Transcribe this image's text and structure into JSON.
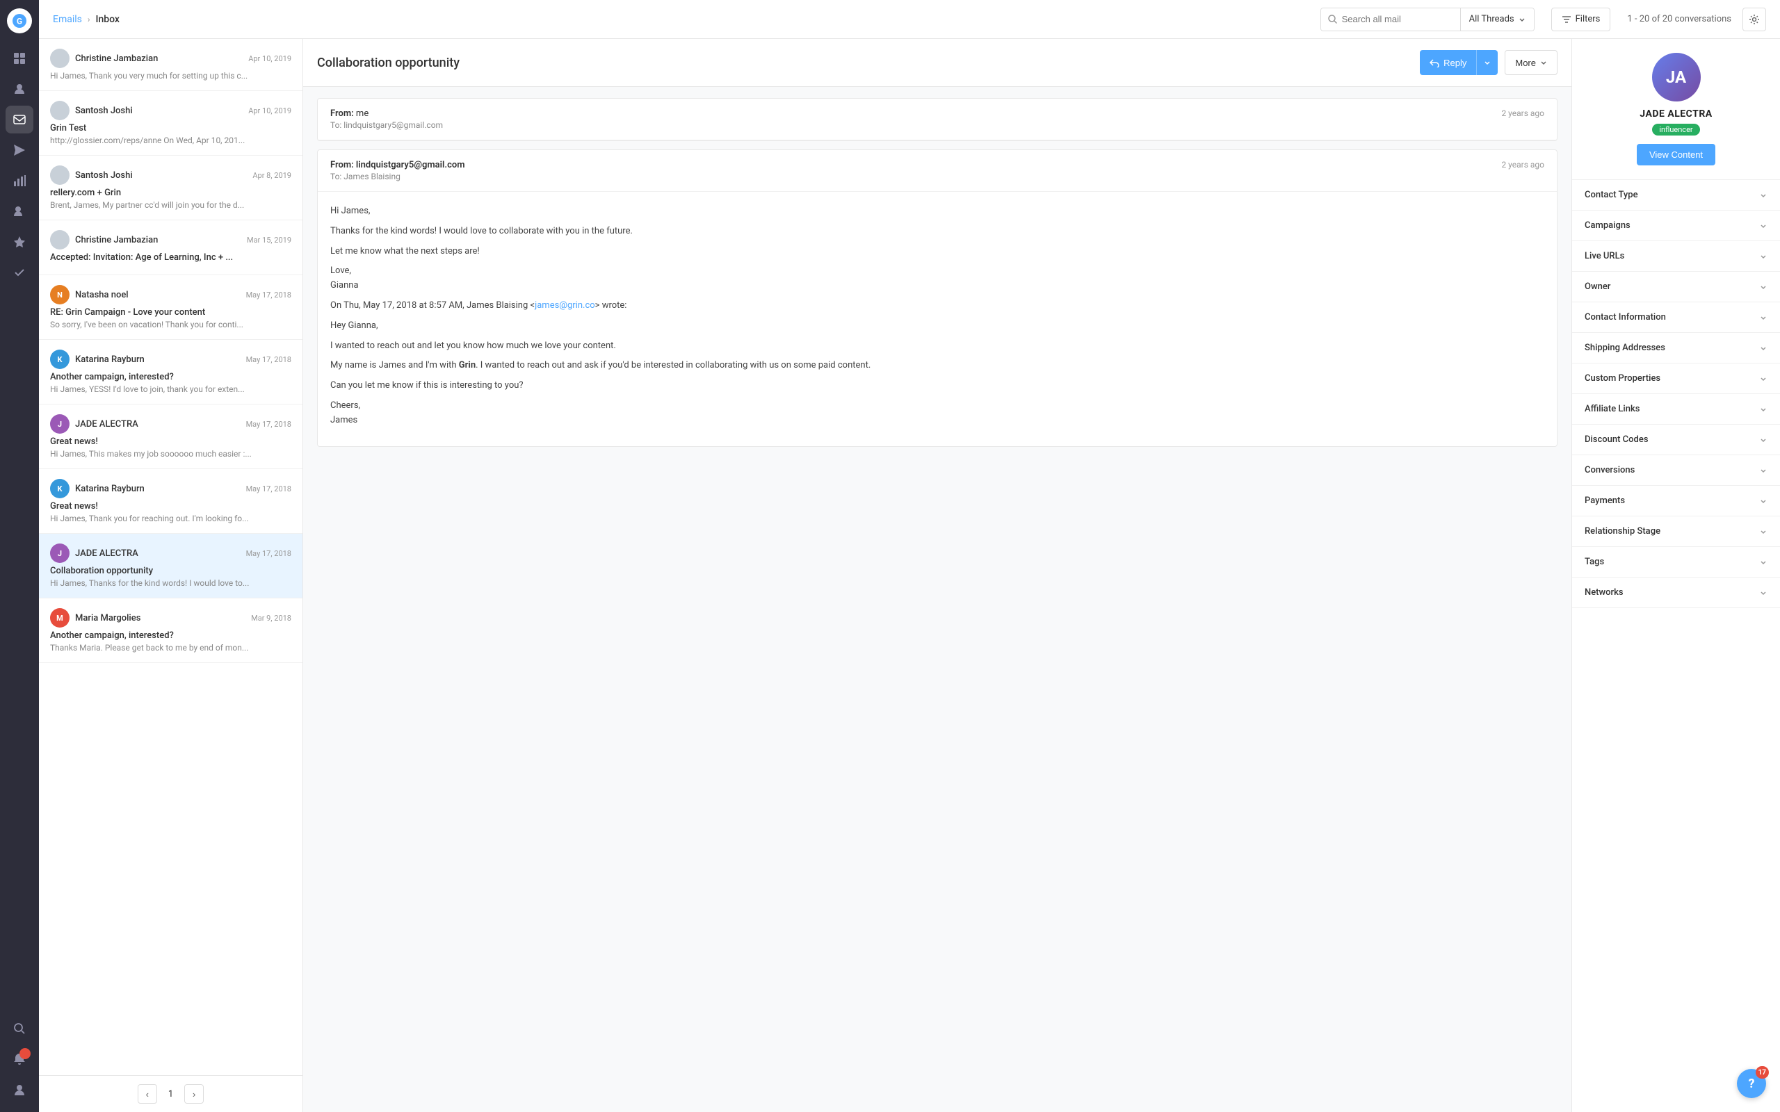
{
  "app": {
    "logo_text": "G"
  },
  "nav": {
    "items": [
      {
        "id": "dashboard",
        "icon": "⊞",
        "active": false
      },
      {
        "id": "contacts",
        "icon": "👤",
        "active": false
      },
      {
        "id": "emails",
        "icon": "✉",
        "active": true
      },
      {
        "id": "send",
        "icon": "➤",
        "active": false
      },
      {
        "id": "reports",
        "icon": "📊",
        "active": false
      },
      {
        "id": "add-user",
        "icon": "➕",
        "active": false
      },
      {
        "id": "starred",
        "icon": "★",
        "active": false
      },
      {
        "id": "checkmark",
        "icon": "✓",
        "active": false
      }
    ],
    "bottom_items": [
      {
        "id": "search",
        "icon": "🔍"
      },
      {
        "id": "alert",
        "icon": "🔔",
        "badge": ""
      },
      {
        "id": "profile",
        "icon": "👤"
      }
    ]
  },
  "header": {
    "breadcrumb_link": "Emails",
    "breadcrumb_sep": "›",
    "breadcrumb_current": "Inbox",
    "search_placeholder": "Search all mail",
    "thread_filter": "All Threads",
    "filter_label": "Filters",
    "conversation_count": "1 - 20 of 20 conversations"
  },
  "email_list": {
    "items": [
      {
        "id": 1,
        "sender": "Christine Jambazian",
        "date": "Apr 10, 2019",
        "subject": "",
        "preview": "Hi James, Thank you very much for setting up this c...",
        "has_avatar": false
      },
      {
        "id": 2,
        "sender": "Santosh Joshi",
        "date": "Apr 10, 2019",
        "subject": "Grin Test",
        "preview": "http://glossier.com/reps/anne On Wed, Apr 10, 201...",
        "has_avatar": false
      },
      {
        "id": 3,
        "sender": "Santosh Joshi",
        "date": "Apr 8, 2019",
        "subject": "rellery.com + Grin",
        "preview": "Brent, James, My partner cc'd will join you for the d...",
        "has_avatar": false
      },
      {
        "id": 4,
        "sender": "Christine Jambazian",
        "date": "Mar 15, 2019",
        "subject": "Accepted: Invitation: Age of Learning, Inc + ...",
        "preview": "",
        "has_avatar": false
      },
      {
        "id": 5,
        "sender": "Natasha noel",
        "date": "May 17, 2018",
        "subject": "RE: Grin Campaign - Love your content",
        "preview": "So sorry, I've been on vacation! Thank you for conti...",
        "has_avatar": true,
        "avatar_color": "#e67e22"
      },
      {
        "id": 6,
        "sender": "Katarina Rayburn",
        "date": "May 17, 2018",
        "subject": "Another campaign, interested?",
        "preview": "Hi James, YESS! I'd love to join, thank you for exten...",
        "has_avatar": true,
        "avatar_color": "#3498db"
      },
      {
        "id": 7,
        "sender": "JADE ALECTRA",
        "date": "May 17, 2018",
        "subject": "Great news!",
        "preview": "Hi James, This makes my job soooooo much easier :...",
        "has_avatar": true,
        "avatar_color": "#9b59b6"
      },
      {
        "id": 8,
        "sender": "Katarina Rayburn",
        "date": "May 17, 2018",
        "subject": "Great news!",
        "preview": "Hi James, Thank you for reaching out. I'm looking fo...",
        "has_avatar": true,
        "avatar_color": "#3498db"
      },
      {
        "id": 9,
        "sender": "JADE ALECTRA",
        "date": "May 17, 2018",
        "subject": "Collaboration opportunity",
        "preview": "Hi James, Thanks for the kind words! I would love to...",
        "has_avatar": true,
        "avatar_color": "#9b59b6",
        "active": true
      },
      {
        "id": 10,
        "sender": "Maria Margolies",
        "date": "Mar 9, 2018",
        "subject": "Another campaign, interested?",
        "preview": "Thanks Maria. Please get back to me by end of mon...",
        "has_avatar": true,
        "avatar_color": "#e74c3c"
      }
    ],
    "pagination": {
      "prev_label": "‹",
      "page": "1",
      "next_label": "›"
    }
  },
  "email_view": {
    "title": "Collaboration opportunity",
    "reply_label": "Reply",
    "more_label": "More",
    "thread": [
      {
        "id": "thread-1",
        "from_label": "From:",
        "from": "me",
        "to_label": "To:",
        "to": "lindquistgary5@gmail.com",
        "time": "2 years ago",
        "body": ""
      },
      {
        "id": "thread-2",
        "from_label": "From:",
        "from": "lindquistgary5@gmail.com",
        "to_label": "To:",
        "to": "James Blaising",
        "time": "2 years ago",
        "greeting": "Hi James,",
        "lines": [
          "Thanks for the kind words! I would love to collaborate with you in the future.",
          "",
          "Let me know what the next steps are!",
          "",
          "Love,",
          "Gianna",
          "",
          "On Thu, May 17, 2018 at 8:57 AM, James Blaising <james@grin.co> wrote:",
          "",
          "Hey Gianna,",
          "",
          "I wanted to reach out and let you know how much we love your content.",
          "",
          "My name is James and I'm with Grin. I wanted to reach out and ask if you'd be interested in collaborating with us on some paid content.",
          "",
          "Can you let me know if this is interesting to you?",
          "",
          "Cheers,",
          "James"
        ]
      }
    ]
  },
  "right_panel": {
    "contact": {
      "name": "JADE ALECTRA",
      "badge": "influencer",
      "view_content_btn": "View Content"
    },
    "accordion_items": [
      {
        "id": "contact-type",
        "label": "Contact Type"
      },
      {
        "id": "campaigns",
        "label": "Campaigns"
      },
      {
        "id": "live-urls",
        "label": "Live URLs"
      },
      {
        "id": "owner",
        "label": "Owner"
      },
      {
        "id": "contact-information",
        "label": "Contact Information"
      },
      {
        "id": "shipping-addresses",
        "label": "Shipping Addresses"
      },
      {
        "id": "custom-properties",
        "label": "Custom Properties"
      },
      {
        "id": "affiliate-links",
        "label": "Affiliate Links"
      },
      {
        "id": "discount-codes",
        "label": "Discount Codes"
      },
      {
        "id": "conversions",
        "label": "Conversions"
      },
      {
        "id": "payments",
        "label": "Payments"
      },
      {
        "id": "relationship-stage",
        "label": "Relationship Stage"
      },
      {
        "id": "tags",
        "label": "Tags"
      },
      {
        "id": "networks",
        "label": "Networks"
      }
    ]
  },
  "help": {
    "badge": "17",
    "label": "?"
  }
}
